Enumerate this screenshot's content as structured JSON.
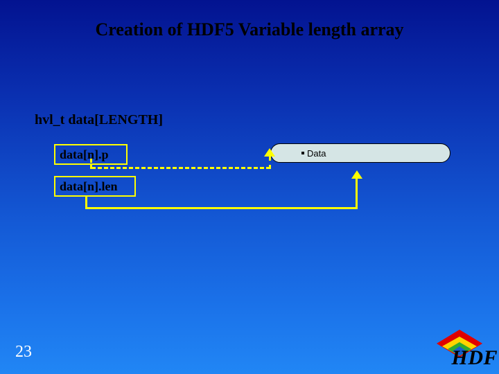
{
  "title": "Creation of HDF5 Variable length array",
  "declaration": "hvl_t data[LENGTH]",
  "fields": {
    "p": "data[n].p",
    "len": "data[n].len"
  },
  "data_label": "Data",
  "page_number": "23",
  "logo_text": "HDF",
  "colors": {
    "highlight": "#ffff00",
    "data_box_fill": "#d5e5e5"
  }
}
